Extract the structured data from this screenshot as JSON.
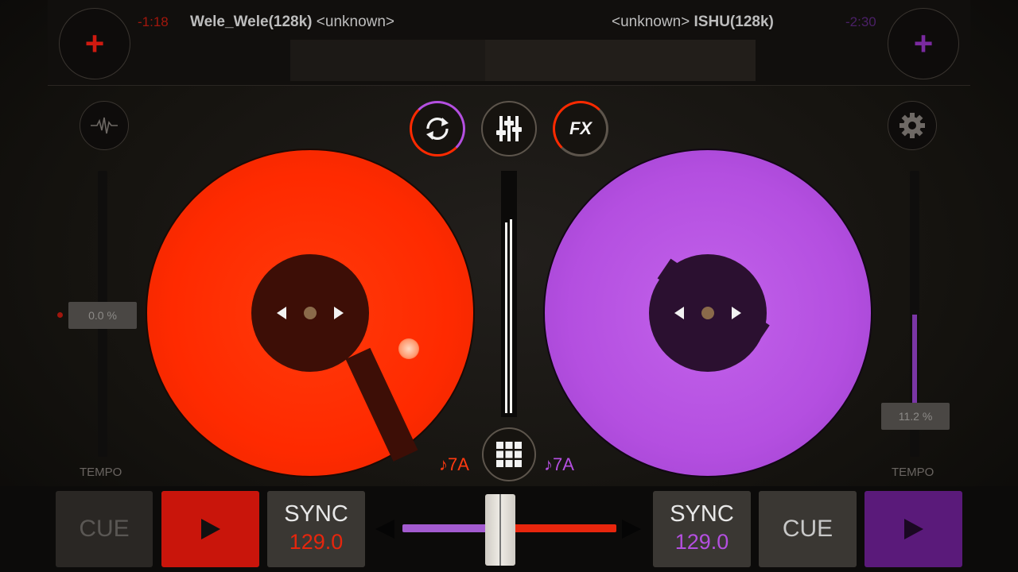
{
  "colors": {
    "deck_a": "#ff2a00",
    "deck_b": "#b44fe0",
    "background": "#15130f"
  },
  "deck_a": {
    "time": "-1:18",
    "title": "Wele_Wele(128k)",
    "artist": "<unknown>",
    "tempo_value": "0.0 %",
    "tempo_label": "TEMPO",
    "key": "♪7A",
    "cue_label": "CUE",
    "sync_label": "SYNC",
    "bpm": "129.0",
    "add_icon": "plus-icon"
  },
  "deck_b": {
    "time": "-2:30",
    "title": "ISHU(128k)",
    "artist": "<unknown>",
    "tempo_value": "11.2 %",
    "tempo_label": "TEMPO",
    "key": "♪7A",
    "cue_label": "CUE",
    "sync_label": "SYNC",
    "bpm": "129.0",
    "add_icon": "plus-icon"
  },
  "center": {
    "loop_icon": "sync-loop-icon",
    "mixer_icon": "mixer-sliders-icon",
    "fx_label": "FX",
    "grid_icon": "grid-icon"
  },
  "crossfader": {
    "position": 0.45
  }
}
